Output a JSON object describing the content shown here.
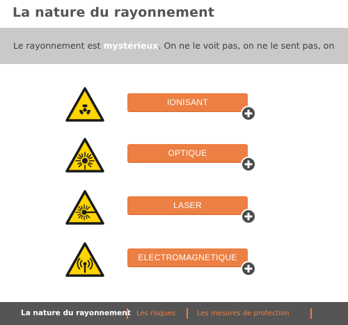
{
  "page": {
    "title": "La nature du rayonnement"
  },
  "intro": {
    "before": "Le rayonnement est ",
    "highlight": "mystérieux",
    "after": ". On ne le voit pas, on ne le sent pas, on"
  },
  "categories": [
    {
      "label": "IONISANT",
      "icon": "radiation-trefoil-icon"
    },
    {
      "label": "OPTIQUE",
      "icon": "optical-radiation-icon"
    },
    {
      "label": "LASER",
      "icon": "laser-icon"
    },
    {
      "label": "ELECTROMAGNETIQUE",
      "icon": "electromagnetic-wave-icon"
    }
  ],
  "footer": {
    "current": "La nature du rayonnement",
    "links": [
      "Les risques",
      "Les mesures de protection"
    ]
  },
  "colors": {
    "accent": "#ec7f43",
    "hazard_yellow": "#ffd400",
    "band_gray": "#c9c9c9",
    "footer_gray": "#555555"
  }
}
